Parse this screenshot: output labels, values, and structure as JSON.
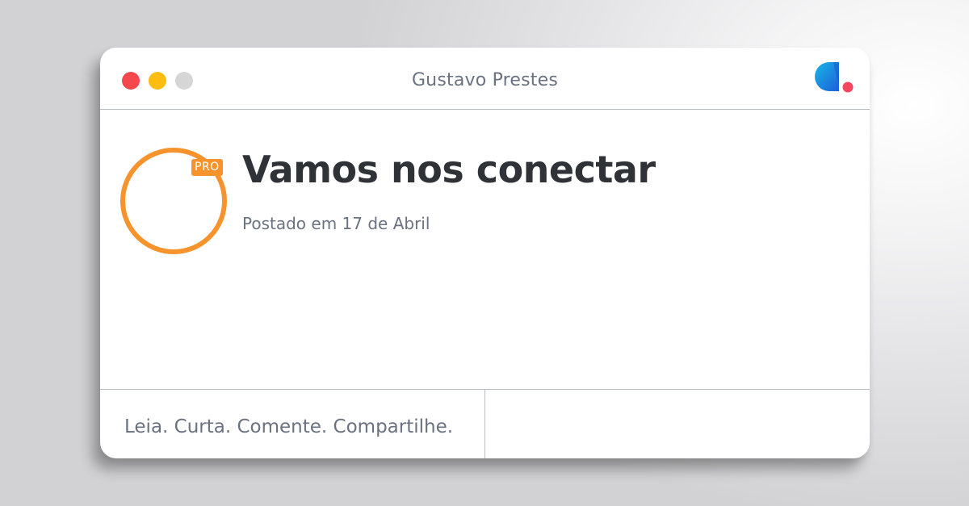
{
  "window": {
    "title": "Gustavo Prestes",
    "controls": [
      {
        "name": "close",
        "color": "#f5474e"
      },
      {
        "name": "minimize",
        "color": "#fcbd0f"
      },
      {
        "name": "maximize",
        "color": "#d6d6d6"
      }
    ],
    "logo_icon": "brand-logo-icon"
  },
  "post": {
    "avatar_badge": "PRO",
    "title": "Vamos nos conectar",
    "date": "Postado em 17 de Abril"
  },
  "footer": {
    "tagline": "Leia. Curta. Comente. Compartilhe."
  },
  "colors": {
    "accent": "#f6932d",
    "title_text": "#2f3237",
    "muted_text": "#6a7180",
    "logo_blue": "#1a6fd8",
    "logo_cyan": "#19b6e6",
    "logo_red": "#f5475d"
  }
}
